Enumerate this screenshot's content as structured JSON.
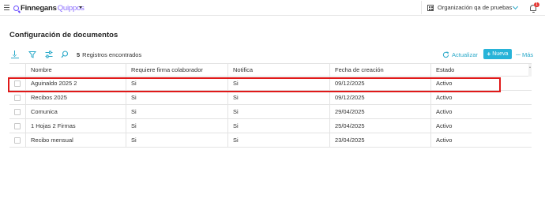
{
  "header": {
    "brand": "Finnegans",
    "product": "Quippos",
    "organization": "Organización qa de pruebas",
    "notification_count": "1"
  },
  "page": {
    "title": "Configuración de documentos"
  },
  "toolbar": {
    "records_count": "5",
    "records_label": "Registros encontrados",
    "refresh_label": "Actualizar",
    "new_label": "Nueva",
    "more_label": "Más"
  },
  "table": {
    "columns": {
      "name": "Nombre",
      "requires_signature": "Requiere firma colaborador",
      "notify": "Notifica",
      "created": "Fecha de creación",
      "status": "Estado"
    },
    "rows": [
      {
        "name": "Aguinaldo 2025 2",
        "requires_signature": "Si",
        "notify": "Si",
        "created": "09/12/2025",
        "status": "Activo"
      },
      {
        "name": "Recibos 2025",
        "requires_signature": "Si",
        "notify": "Si",
        "created": "09/12/2025",
        "status": "Activo"
      },
      {
        "name": "Comunica",
        "requires_signature": "Si",
        "notify": "Si",
        "created": "29/04/2025",
        "status": "Activo"
      },
      {
        "name": "1 Hojas 2 Firmas",
        "requires_signature": "Si",
        "notify": "Si",
        "created": "25/04/2025",
        "status": "Activo"
      },
      {
        "name": "Recibo mensual",
        "requires_signature": "Si",
        "notify": "Si",
        "created": "23/04/2025",
        "status": "Activo"
      }
    ]
  },
  "colors": {
    "accent": "#27b3d8",
    "brand_purple": "#6a4cff",
    "highlight": "#e01919",
    "badge": "#e53935"
  },
  "icons": {
    "menu": "hamburger-icon",
    "org": "building-icon",
    "notifications": "bell-icon",
    "download": "download-icon",
    "filter": "filter-icon",
    "columns": "sliders-icon",
    "search": "search-icon",
    "refresh": "refresh-icon"
  }
}
